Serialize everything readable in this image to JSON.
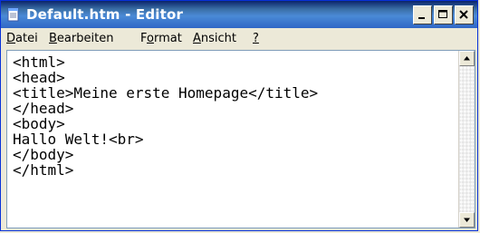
{
  "window": {
    "title": "Default.htm - Editor"
  },
  "menubar": {
    "items": [
      {
        "label": "Datei",
        "underline": "D",
        "rest": "atei"
      },
      {
        "label": "Bearbeiten",
        "underline": "B",
        "rest": "earbeiten"
      },
      {
        "label": "Format",
        "pre": "F",
        "underline": "o",
        "rest": "rmat"
      },
      {
        "label": "Ansicht",
        "underline": "A",
        "rest": "nsicht"
      },
      {
        "label": "?",
        "underline": "?",
        "rest": ""
      }
    ]
  },
  "editor": {
    "lines": [
      "<html>",
      "<head>",
      "<title>Meine erste Homepage</title>",
      "</head>",
      "<body>",
      "Hallo Welt!<br>",
      "</body>",
      "</html>"
    ]
  },
  "icons": {
    "app": "notepad-icon",
    "minimize": "minimize-icon",
    "maximize": "maximize-icon",
    "close": "close-icon",
    "scroll_up": "arrow-up-icon",
    "scroll_down": "arrow-down-icon"
  },
  "colors": {
    "titlebar": "#2f67c6",
    "window_bg": "#ece9d8",
    "editor_bg": "#ffffff"
  }
}
